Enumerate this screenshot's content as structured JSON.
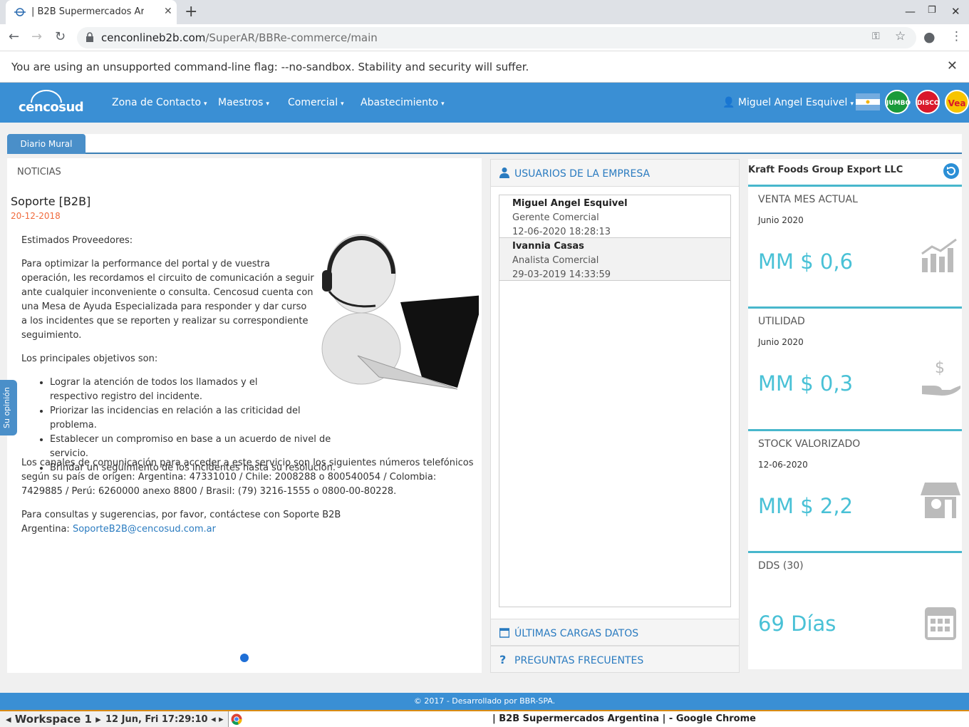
{
  "browser": {
    "tab_title": "| B2B Supermercados Argentina",
    "url_host": "cenconlineb2b.com",
    "url_path": "/SuperAR/BBRe-commerce/main",
    "infobar": "You are using an unsupported command-line flag: --no-sandbox. Stability and security will suffer."
  },
  "header": {
    "logo": "cencosud",
    "menu": [
      "Zona de Contacto",
      "Maestros",
      "Comercial",
      "Abastecimiento"
    ],
    "user": "Miguel Angel Esquivel",
    "brands": [
      "JUMBO",
      "DISCO",
      "Vea"
    ],
    "accent": "#3a8fd4"
  },
  "tabs": {
    "active": "Diario Mural"
  },
  "news": {
    "section": "NOTICIAS",
    "title": "Soporte [B2B]",
    "date": "20-12-2018",
    "greeting": "Estimados Proveedores:",
    "intro": "Para optimizar la performance del portal y de vuestra operación, les recordamos el circuito de comunicación a seguir ante cualquier inconveniente o consulta. Cencosud cuenta con una Mesa de Ayuda Especializada para responder y dar curso a los incidentes que se reporten y realizar su correspondiente seguimiento.",
    "objectives_title": "Los principales objetivos son:",
    "objectives": [
      "Lograr la atención de todos los llamados y el respectivo registro del incidente.",
      "Priorizar las incidencias en relación a las criticidad del problema.",
      "Establecer un compromiso en base a un acuerdo de nivel de servicio.",
      "Brindar un seguimiento de los incidentes hasta su resolución."
    ],
    "channels": "Los canales de comunicación para acceder a este servicio son los siguientes números telefónicos según su país de origen: Argentina: 47331010 / Chile: 2008288 o 800540054 / Colombia: 7429885 / Perú: 6260000 anexo 8800 / Brasil: (79) 3216-1555 o 0800-00-80228.",
    "contact_line1": "Para consultas y sugerencias, por favor, contáctese con Soporte B2B",
    "contact_prefix": "Argentina: ",
    "contact_email": "SoporteB2B@cencosud.com.ar",
    "feedback_tab": "Su opinión"
  },
  "users_panel": {
    "title": "USUARIOS DE LA EMPRESA",
    "users": [
      {
        "name": "Miguel Angel Esquivel",
        "role": "Gerente Comercial",
        "date": "12-06-2020 18:28:13"
      },
      {
        "name": "Ivannia Casas",
        "role": "Analista Comercial",
        "date": "29-03-2019 14:33:59"
      }
    ],
    "last_loads": "ÚLTIMAS CARGAS DATOS",
    "faq": "PREGUNTAS FRECUENTES"
  },
  "kpi": {
    "company": "Kraft Foods Group Export LLC",
    "boxes": [
      {
        "title": "VENTA MES ACTUAL",
        "sub": "Junio 2020",
        "value": "MM $ 0,6",
        "icon": "chart-icon"
      },
      {
        "title": "UTILIDAD",
        "sub": "Junio 2020",
        "value": "MM $ 0,3",
        "icon": "money-hand-icon"
      },
      {
        "title": "STOCK VALORIZADO",
        "sub": "12-06-2020",
        "value": "MM $ 2,2",
        "icon": "store-icon"
      },
      {
        "title": "DDS (30)",
        "sub": "",
        "value": "69 Días",
        "icon": "calendar-icon"
      }
    ],
    "value_color": "#49c1d6"
  },
  "footer": "© 2017 - Desarrollado por BBR-SPA.",
  "taskbar": {
    "workspace": "Workspace 1",
    "clock": "12 Jun, Fri 17:29:10",
    "window": "| B2B Supermercados Argentina | - Google Chrome"
  }
}
